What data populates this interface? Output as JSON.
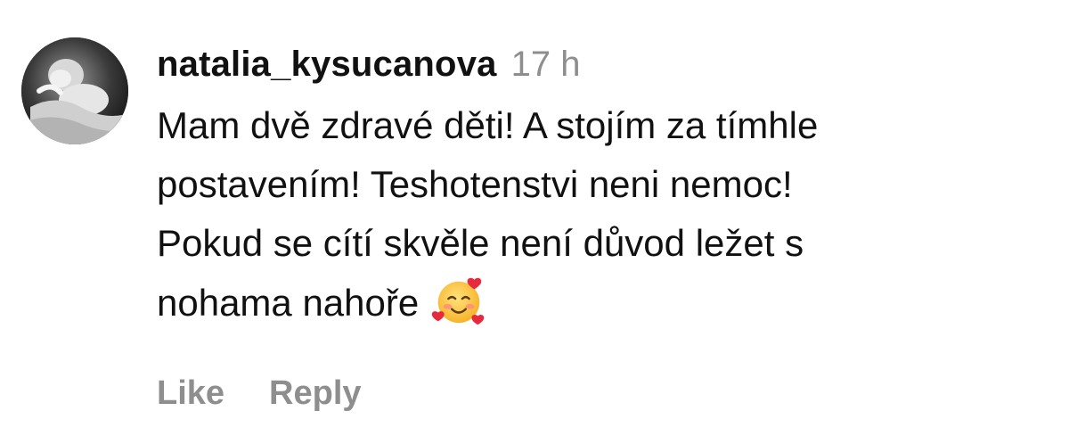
{
  "comment": {
    "username": "natalia_kysucanova",
    "timestamp": "17 h",
    "text_lines": [
      "Mam dvě zdravé děti! A stojím za tímhle",
      "postavením! Teshotenstvi neni nemoc!",
      "Pokud se cítí skvěle není důvod ležet s",
      "nohama nahoře"
    ],
    "emoji": "smiling-face-with-hearts-icon"
  },
  "actions": {
    "like_label": "Like",
    "reply_label": "Reply"
  },
  "colors": {
    "text": "#111111",
    "muted": "#8e8e8e",
    "background": "#ffffff"
  }
}
